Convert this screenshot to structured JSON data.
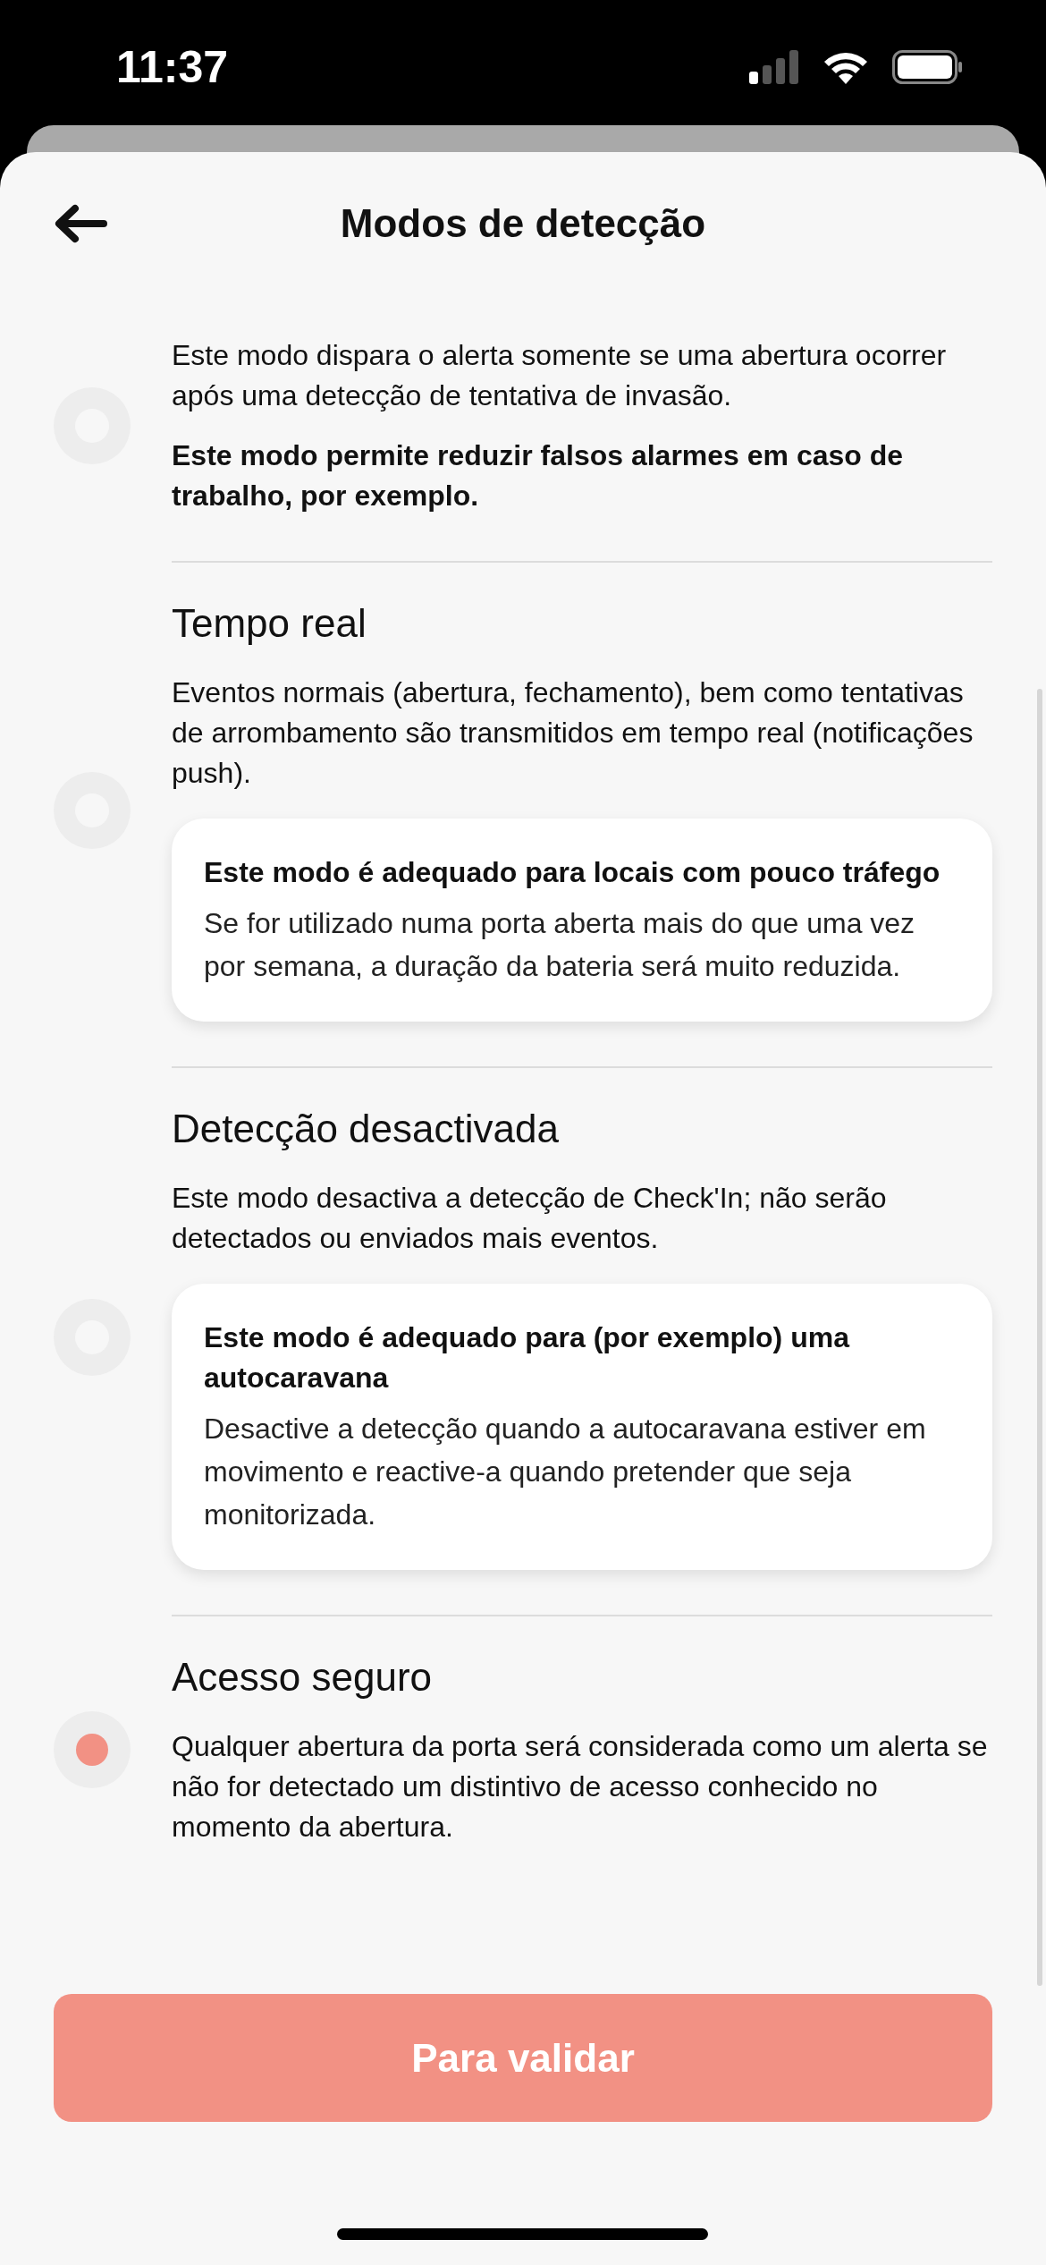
{
  "status_bar": {
    "time": "11:37"
  },
  "header": {
    "title": "Modos de detecção"
  },
  "modes": [
    {
      "description": "Este modo dispara o alerta somente se uma abertura ocorrer após uma detecção de tentativa de invasão.",
      "note": "Este modo permite reduzir falsos alarmes em caso de trabalho, por exemplo.",
      "selected": false
    },
    {
      "title": "Tempo real",
      "description": "Eventos normais (abertura, fechamento), bem como tentativas de arrombamento são transmitidos em tempo real (notificações push).",
      "card": {
        "title": "Este modo é adequado para locais com pouco tráfego",
        "text": "Se for utilizado numa porta aberta mais do que uma vez por semana, a duração da bateria será muito reduzida."
      },
      "selected": false
    },
    {
      "title": "Detecção desactivada",
      "description": "Este modo desactiva a detecção de Check'In; não serão detectados ou enviados mais eventos.",
      "card": {
        "title": "Este modo é adequado para (por exemplo) uma autocaravana",
        "text": "Desactive a detecção quando a autocaravana estiver em movimento e reactive-a quando pretender que seja monitorizada."
      },
      "selected": false
    },
    {
      "title": "Acesso seguro",
      "description": "Qualquer abertura da porta será considerada como um alerta se não for detectado um distintivo de acesso conhecido no momento da abertura.",
      "selected": true
    }
  ],
  "button": {
    "label": "Para validar"
  }
}
